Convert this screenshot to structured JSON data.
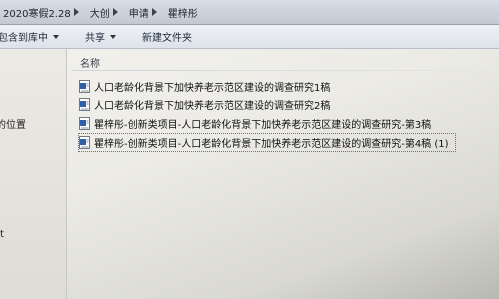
{
  "breadcrumb": {
    "items": [
      "2020寒假2.28",
      "大创",
      "申请",
      "瞿梓彤"
    ]
  },
  "toolbar": {
    "include_in_library": "包含到库中",
    "share": "共享",
    "new_folder": "新建文件夹"
  },
  "nav": {
    "items": [
      "的位置",
      "t"
    ]
  },
  "file_list": {
    "column_name": "名称",
    "files": [
      {
        "name": "人口老龄化背景下加快养老示范区建设的调查研究1稿"
      },
      {
        "name": "人口老龄化背景下加快养老示范区建设的调查研究2稿"
      },
      {
        "name": "瞿梓彤-创新类项目-人口老龄化背景下加快养老示范区建设的调查研究-第3稿"
      },
      {
        "name": "瞿梓彤-创新类项目-人口老龄化背景下加快养老示范区建设的调查研究-第4稿 (1)"
      }
    ]
  }
}
